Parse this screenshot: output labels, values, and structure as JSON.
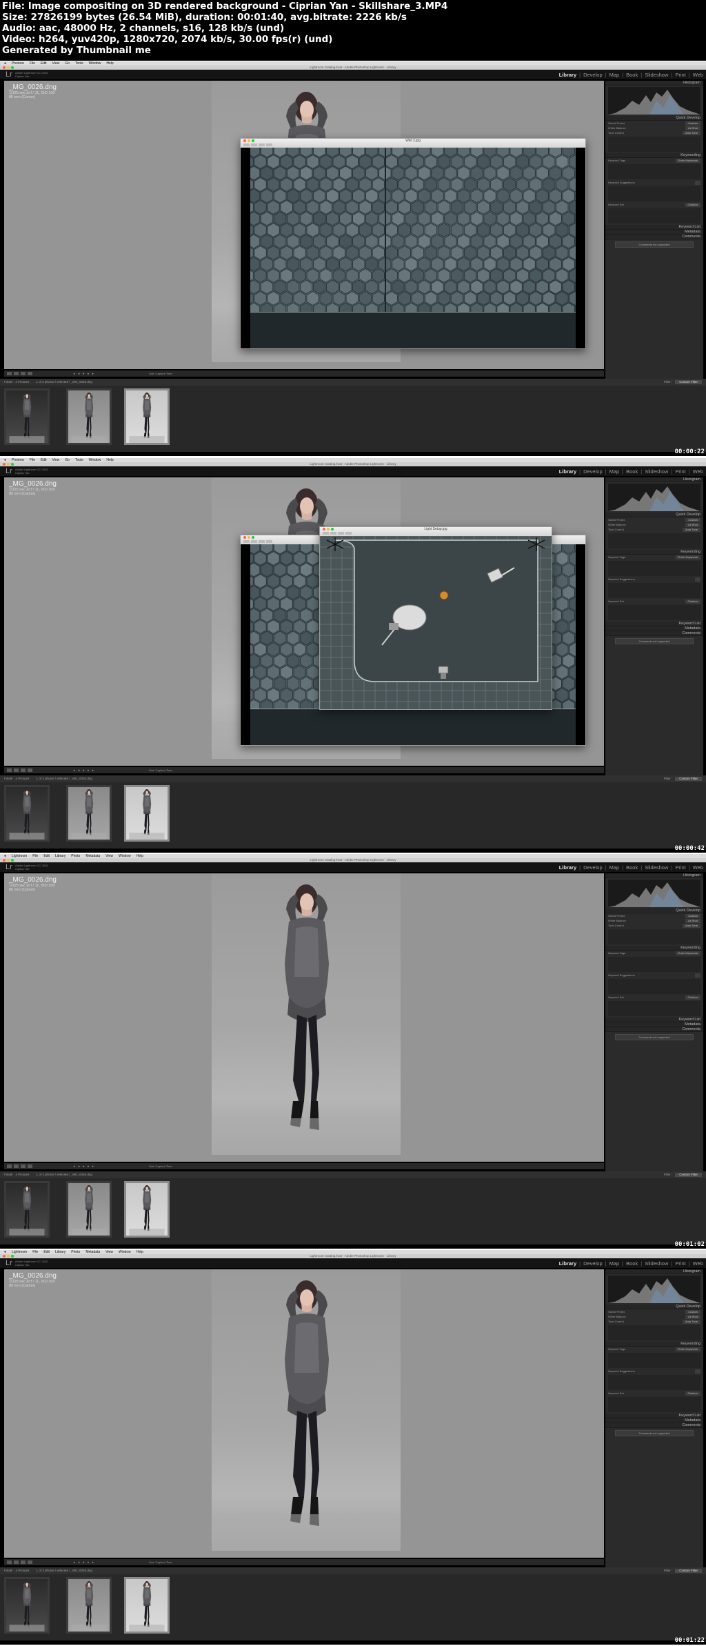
{
  "info": {
    "line1": "File: Image compositing on 3D rendered background - Ciprian Yan - Skillshare_3.MP4",
    "line2": "Size: 27826199 bytes (26.54 MiB), duration: 00:01:40, avg.bitrate: 2226 kb/s",
    "line3": "Audio: aac, 48000 Hz, 2 channels, s16, 128 kb/s (und)",
    "line4": "Video: h264, yuv420p, 1280x720, 2074 kb/s, 30.00 fps(r) (und)",
    "line5": "Generated by Thumbnail me"
  },
  "lightroom": {
    "logo": "Lr",
    "user_line1": "Adobe Lightroom CC 2015",
    "user_line2": "Ciprian Yan",
    "modules": [
      "Library",
      "Develop",
      "Map",
      "Book",
      "Slideshow",
      "Print",
      "Web"
    ],
    "separator": "|",
    "photo_filename": "_MG_0026.dng",
    "photo_exposure": "1/125 sec at f / 11, ISO 100",
    "photo_lens": "85 mm (Canon)",
    "panel_headers": [
      "Histogram",
      "Quick Develop",
      "Keywording",
      "Keyword List",
      "Metadata",
      "Comments"
    ],
    "quick_develop_rows": [
      {
        "label": "Saved Preset",
        "value": "Custom"
      },
      {
        "label": "White Balance",
        "value": "As Shot"
      },
      {
        "label": "Tone Control",
        "value": "Auto Tone"
      }
    ],
    "keyword_rows": [
      {
        "label": "Keyword Tags",
        "value": "Enter Keywords"
      },
      {
        "label": "Keyword Suggestions",
        "value": ""
      },
      {
        "label": "Keyword Set",
        "value": "Outdoor"
      }
    ],
    "comment_button": "Comments not supported",
    "toolbar_stars": "★ ★ ★ ★ ★",
    "toolbar_sort": "Sort: Capture Time",
    "filmbar_source": "Folder : 4 Pictures",
    "filmbar_count": "1 of 3 photos / selected / _MG_0026.dng",
    "filmbar_filter": "Filter :",
    "filmbar_filter_value": "Custom Filter"
  },
  "frames": [
    {
      "mac_menu": [
        "Preview",
        "File",
        "Edit",
        "View",
        "Go",
        "Tools",
        "Window",
        "Help"
      ],
      "window_title": "Lightroom Catalog.lrcat - Adobe Photoshop Lightroom - Library",
      "timestamp": "00:00:22",
      "overlays": [
        {
          "title": "Wall 3.jpg",
          "type": "hex"
        }
      ]
    },
    {
      "mac_menu": [
        "Preview",
        "File",
        "Edit",
        "View",
        "Go",
        "Tools",
        "Window",
        "Help"
      ],
      "window_title": "Lightroom Catalog.lrcat - Adobe Photoshop Lightroom - Library",
      "timestamp": "00:00:42",
      "overlays": [
        {
          "title": "Wall 3.jpg",
          "type": "hex"
        },
        {
          "title": "Light Setup.jpg",
          "type": "studio"
        }
      ]
    },
    {
      "mac_menu": [
        "Lightroom",
        "File",
        "Edit",
        "Library",
        "Photo",
        "Metadata",
        "View",
        "Window",
        "Help"
      ],
      "window_title": "Lightroom Catalog.lrcat - Adobe Photoshop Lightroom - Library",
      "timestamp": "00:01:02",
      "overlays": []
    },
    {
      "mac_menu": [
        "Lightroom",
        "File",
        "Edit",
        "Library",
        "Photo",
        "Metadata",
        "View",
        "Window",
        "Help"
      ],
      "window_title": "Lightroom Catalog.lrcat - Adobe Photoshop Lightroom - Library",
      "timestamp": "00:01:22",
      "overlays": []
    }
  ],
  "colors": {
    "background_gray": "#959595",
    "panel_dark": "#2b2b2b",
    "filmstrip": "#282828",
    "hex_wall": "#5b6b73",
    "studio_grid": "#465257",
    "traffic_red": "#ff5f57",
    "traffic_yellow": "#febc2e",
    "traffic_green": "#28c840"
  },
  "icons": [
    "apple-icon",
    "lightroom-logo",
    "grid-view-icon",
    "loupe-view-icon",
    "compare-view-icon",
    "survey-view-icon",
    "star-icon",
    "light-stand-icon",
    "softbox-icon",
    "camera-icon"
  ]
}
